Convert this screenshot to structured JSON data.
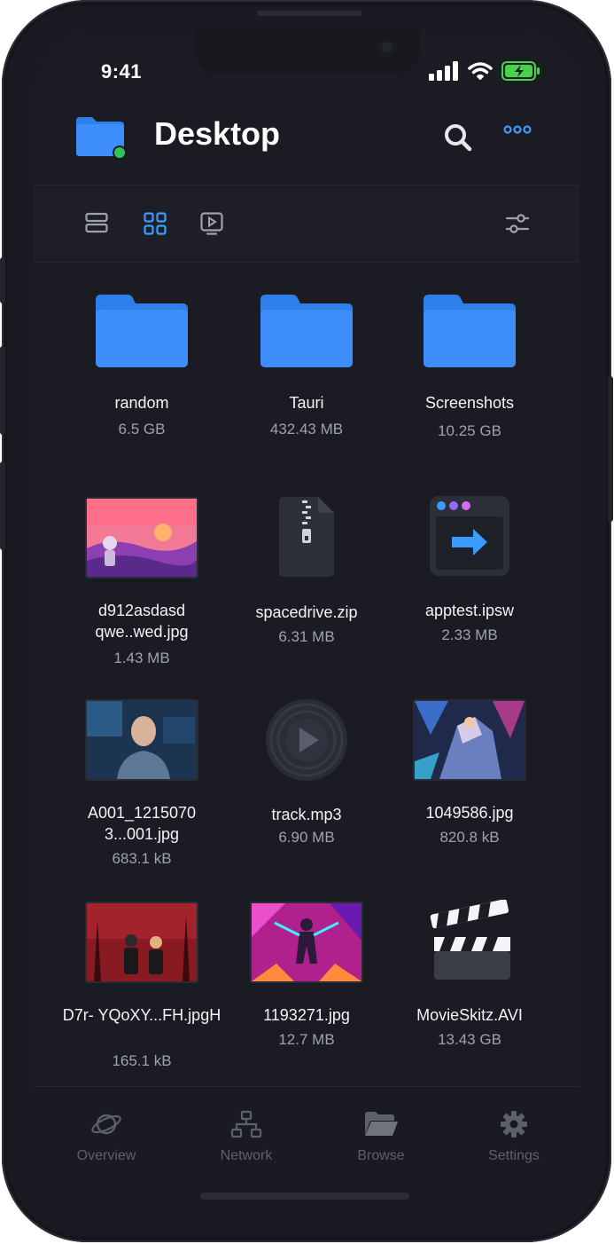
{
  "status_bar": {
    "time": "9:41"
  },
  "header": {
    "title": "Desktop"
  },
  "colors": {
    "accent": "#3b9cff",
    "folder": "#3d8dfb",
    "online": "#2fc15a",
    "battery": "#48d14d"
  },
  "files": [
    {
      "name": "random",
      "size": "6.5 GB",
      "kind": "folder"
    },
    {
      "name": "Tauri",
      "size": "432.43 MB",
      "kind": "folder"
    },
    {
      "name": "Screenshots",
      "size": "10.25 GB",
      "kind": "folder"
    },
    {
      "name": "d912asdasd qwe..wed.jpg",
      "size": "1.43 MB",
      "kind": "image"
    },
    {
      "name": "spacedrive.zip",
      "size": "6.31 MB",
      "kind": "zip"
    },
    {
      "name": "apptest.ipsw",
      "size": "2.33 MB",
      "kind": "app"
    },
    {
      "name": "A001_1215070 3...001.jpg",
      "size": "683.1 kB",
      "kind": "image"
    },
    {
      "name": "track.mp3",
      "size": "6.90 MB",
      "kind": "audio"
    },
    {
      "name": "1049586.jpg",
      "size": "820.8 kB",
      "kind": "image"
    },
    {
      "name": "D7r- YQoXY...FH.jpgH",
      "size": "165.1 kB",
      "kind": "image"
    },
    {
      "name": "1193271.jpg",
      "size": "12.7 MB",
      "kind": "image"
    },
    {
      "name": "MovieSkitz.AVI",
      "size": "13.43 GB",
      "kind": "video"
    }
  ],
  "tabs": [
    {
      "label": "Overview",
      "icon": "planet-icon"
    },
    {
      "label": "Network",
      "icon": "network-icon"
    },
    {
      "label": "Browse",
      "icon": "folder-open-icon"
    },
    {
      "label": "Settings",
      "icon": "gear-icon"
    }
  ]
}
